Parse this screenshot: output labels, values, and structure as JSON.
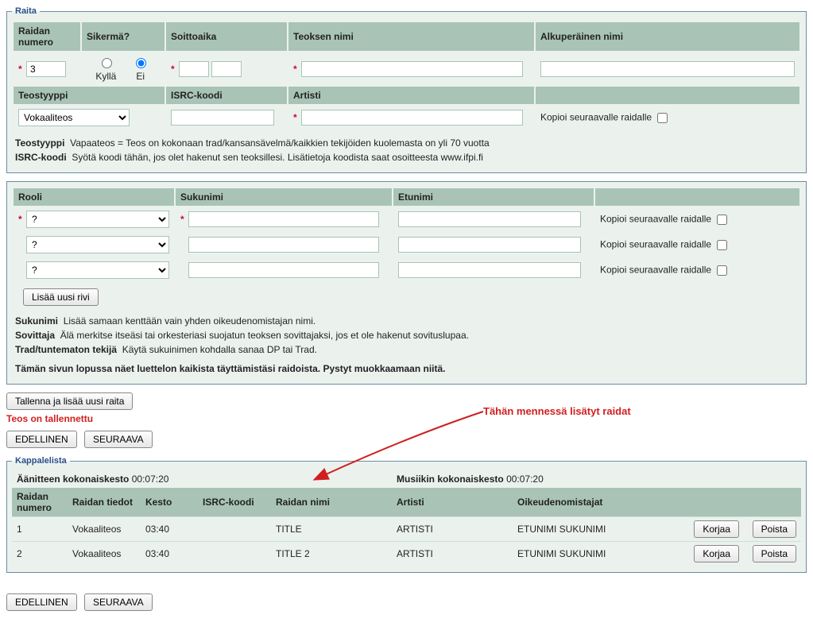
{
  "raita": {
    "legend": "Raita",
    "headers": {
      "raidan_numero": "Raidan numero",
      "sikerma": "Sikermä?",
      "soittoaika": "Soittoaika",
      "teoksen_nimi": "Teoksen nimi",
      "alkuperainen_nimi": "Alkuperäinen nimi",
      "teostyyppi": "Teostyyppi",
      "isrc": "ISRC-koodi",
      "artisti": "Artisti"
    },
    "values": {
      "raidan_numero": "3",
      "sikerma_kylla": "Kyllä",
      "sikerma_ei": "Ei",
      "teostyyppi_selected": "Vokaaliteos",
      "kopioi_label": "Kopioi seuraavalle raidalle"
    },
    "info": {
      "teostyyppi_label": "Teostyyppi",
      "teostyyppi_text": "Vapaateos = Teos on kokonaan trad/kansansävelmä/kaikkien tekijöiden kuolemasta on yli 70 vuotta",
      "isrc_label": "ISRC-koodi",
      "isrc_text": "Syötä koodi tähän, jos olet hakenut sen teoksillesi. Lisätietoja koodista saat osoitteesta www.ifpi.fi"
    }
  },
  "roles": {
    "headers": {
      "rooli": "Rooli",
      "sukunimi": "Sukunimi",
      "etunimi": "Etunimi"
    },
    "kopioi_label": "Kopioi seuraavalle raidalle",
    "role_option": "?",
    "add_row": "Lisää uusi rivi",
    "help": {
      "sukunimi_label": "Sukunimi",
      "sukunimi_text": "Lisää samaan kenttään vain yhden oikeudenomistajan nimi.",
      "sovittaja_label": "Sovittaja",
      "sovittaja_text": "Älä merkitse itseäsi tai orkesteriasi suojatun teoksen sovittajaksi, jos et ole hakenut sovituslupaa.",
      "trad_label": "Trad/tuntematon tekijä",
      "trad_text": "Käytä sukuinimen kohdalla sanaa DP tai Trad.",
      "footer": "Tämän sivun lopussa näet luettelon kaikista täyttämistäsi raidoista. Pystyt muokkaamaan niitä."
    }
  },
  "actions": {
    "save_add": "Tallenna ja lisää uusi raita",
    "status": "Teos on tallennettu",
    "prev": "EDELLINEN",
    "next": "SEURAAVA"
  },
  "annotation": "Tähän mennessä lisätyt raidat",
  "kappalelista": {
    "legend": "Kappalelista",
    "aanite_label": "Äänitteen kokonaiskesto",
    "aanite_value": "00:07:20",
    "musiikki_label": "Musiikin kokonaiskesto",
    "musiikki_value": "00:07:20",
    "cols": {
      "raidan_numero": "Raidan numero",
      "raidan_tiedot": "Raidan tiedot",
      "kesto": "Kesto",
      "isrc": "ISRC-koodi",
      "raidan_nimi": "Raidan nimi",
      "artisti": "Artisti",
      "oikeuden": "Oikeudenomistajat"
    },
    "rows": [
      {
        "num": "1",
        "tiedot": "Vokaaliteos",
        "kesto": "03:40",
        "isrc": "",
        "nimi": "TITLE",
        "artisti": "ARTISTI",
        "oik": "ETUNIMI SUKUNIMI"
      },
      {
        "num": "2",
        "tiedot": "Vokaaliteos",
        "kesto": "03:40",
        "isrc": "",
        "nimi": "TITLE 2",
        "artisti": "ARTISTI",
        "oik": "ETUNIMI SUKUNIMI"
      }
    ],
    "korjaa": "Korjaa",
    "poista": "Poista"
  }
}
